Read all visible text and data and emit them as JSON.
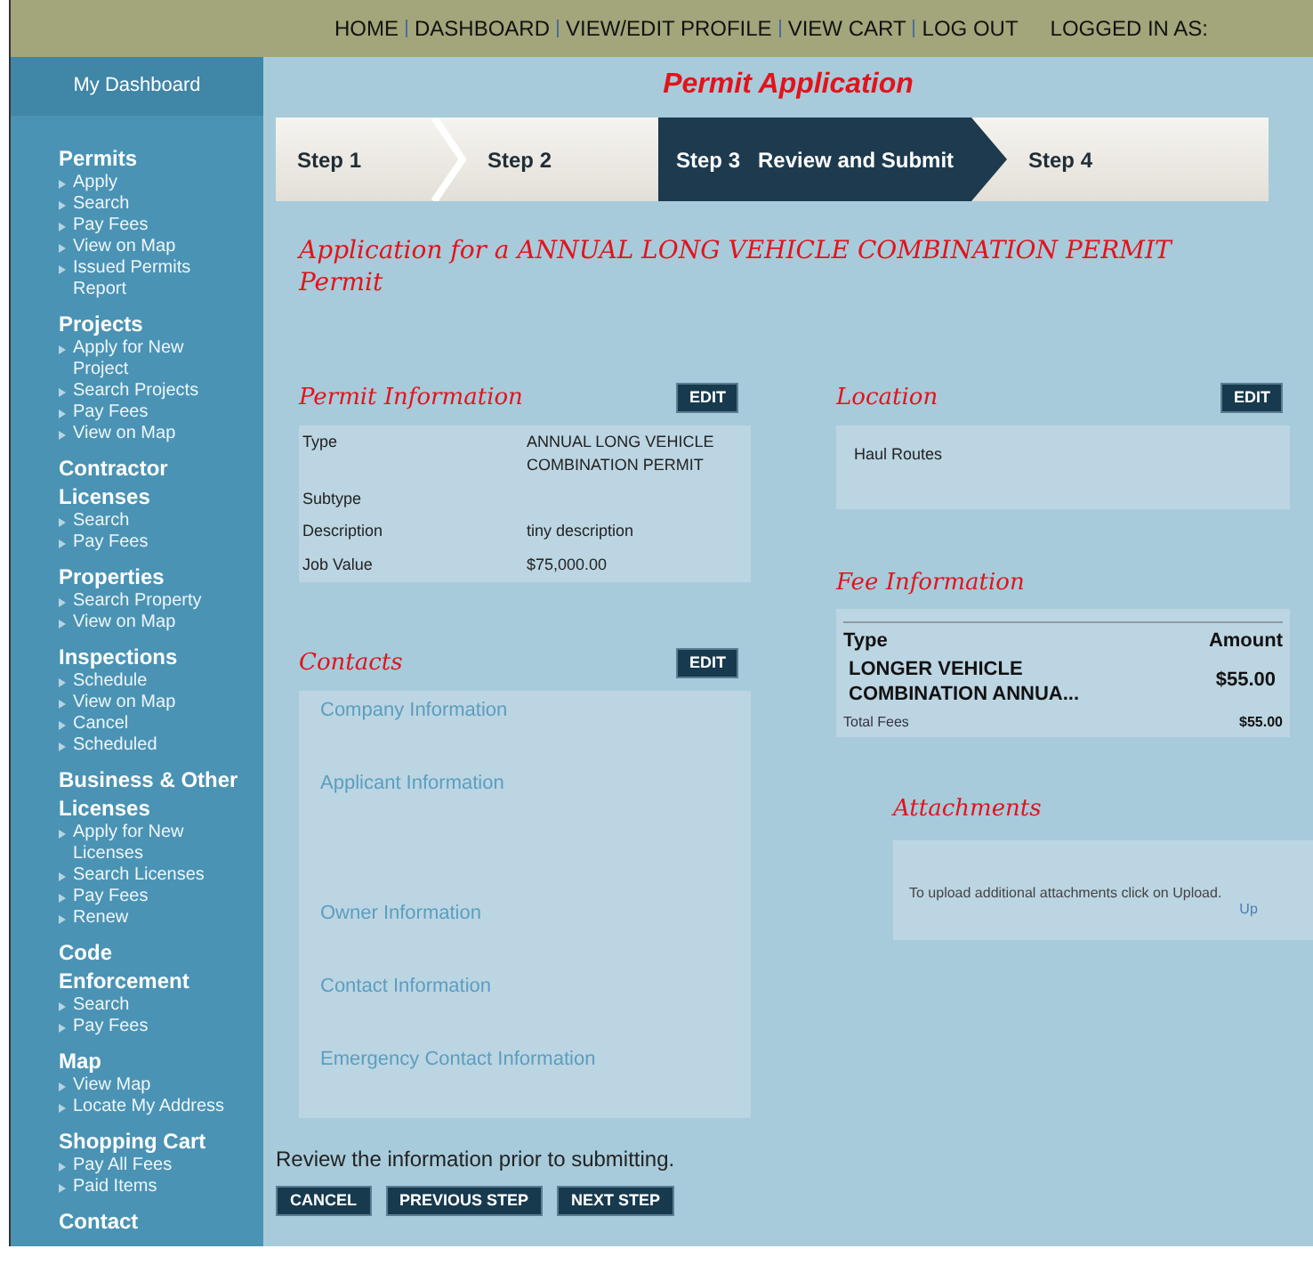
{
  "top_nav": {
    "links": [
      "HOME",
      "DASHBOARD",
      "VIEW/EDIT PROFILE",
      "VIEW CART",
      "LOG OUT"
    ],
    "logged_in_label": "LOGGED IN AS:"
  },
  "sidebar": {
    "header": "My Dashboard",
    "sections": [
      {
        "title": "Permits",
        "items": [
          "Apply",
          "Search",
          "Pay Fees",
          "View on Map",
          "Issued Permits Report"
        ]
      },
      {
        "title": "Projects",
        "items": [
          "Apply for New Project",
          "Search Projects",
          "Pay Fees",
          "View on Map"
        ]
      },
      {
        "title": "Contractor Licenses",
        "items": [
          "Search",
          "Pay Fees"
        ]
      },
      {
        "title": "Properties",
        "items": [
          "Search Property",
          "View on Map"
        ]
      },
      {
        "title": "Inspections",
        "items": [
          "Schedule",
          "View on Map",
          "Cancel",
          "Scheduled"
        ]
      },
      {
        "title": "Business & Other Licenses",
        "items": [
          "Apply for New Licenses",
          "Search Licenses",
          "Pay Fees",
          "Renew"
        ]
      },
      {
        "title": "Code Enforcement",
        "items": [
          "Search",
          "Pay Fees"
        ]
      },
      {
        "title": "Map",
        "items": [
          "View Map",
          "Locate My Address"
        ]
      },
      {
        "title": "Shopping Cart",
        "items": [
          "Pay All Fees",
          "Paid Items"
        ]
      },
      {
        "title": "Contact"
      }
    ]
  },
  "page_title": "Permit Application",
  "steps": [
    {
      "label": "Step 1",
      "selected": false
    },
    {
      "label": "Step 2",
      "selected": false
    },
    {
      "label": "Step 3   Review and Submit",
      "selected": true
    },
    {
      "label": "Step 4",
      "selected": false
    }
  ],
  "application_heading": "Application for a ANNUAL LONG VEHICLE COMBINATION PERMIT Permit",
  "permit_information": {
    "title": "Permit Information",
    "edit": "EDIT",
    "rows": [
      {
        "label": "Type",
        "value": "ANNUAL LONG VEHICLE COMBINATION PERMIT"
      },
      {
        "label": "Subtype",
        "value": ""
      },
      {
        "label": "Description",
        "value": "tiny description"
      },
      {
        "label": "Job Value",
        "value": "$75,000.00"
      }
    ]
  },
  "contacts": {
    "title": "Contacts",
    "edit": "EDIT",
    "groups": [
      "Company Information",
      "Applicant Information",
      "Owner Information",
      "Contact Information",
      "Emergency Contact Information"
    ]
  },
  "location": {
    "title": "Location",
    "edit": "EDIT",
    "items": [
      "Haul Routes"
    ]
  },
  "fee_information": {
    "title": "Fee Information",
    "columns": [
      "Type",
      "Amount"
    ],
    "rows": [
      {
        "type": "LONGER VEHICLE COMBINATION ANNUA...",
        "amount": "$55.00"
      }
    ],
    "total_label": "Total Fees",
    "total": "$55.00"
  },
  "attachments": {
    "title": "Attachments",
    "message": "To upload additional attachments click on Upload.",
    "link": "Up"
  },
  "review_note": "Review the information prior to submitting.",
  "buttons": [
    "CANCEL",
    "PREVIOUS STEP",
    "NEXT STEP"
  ]
}
